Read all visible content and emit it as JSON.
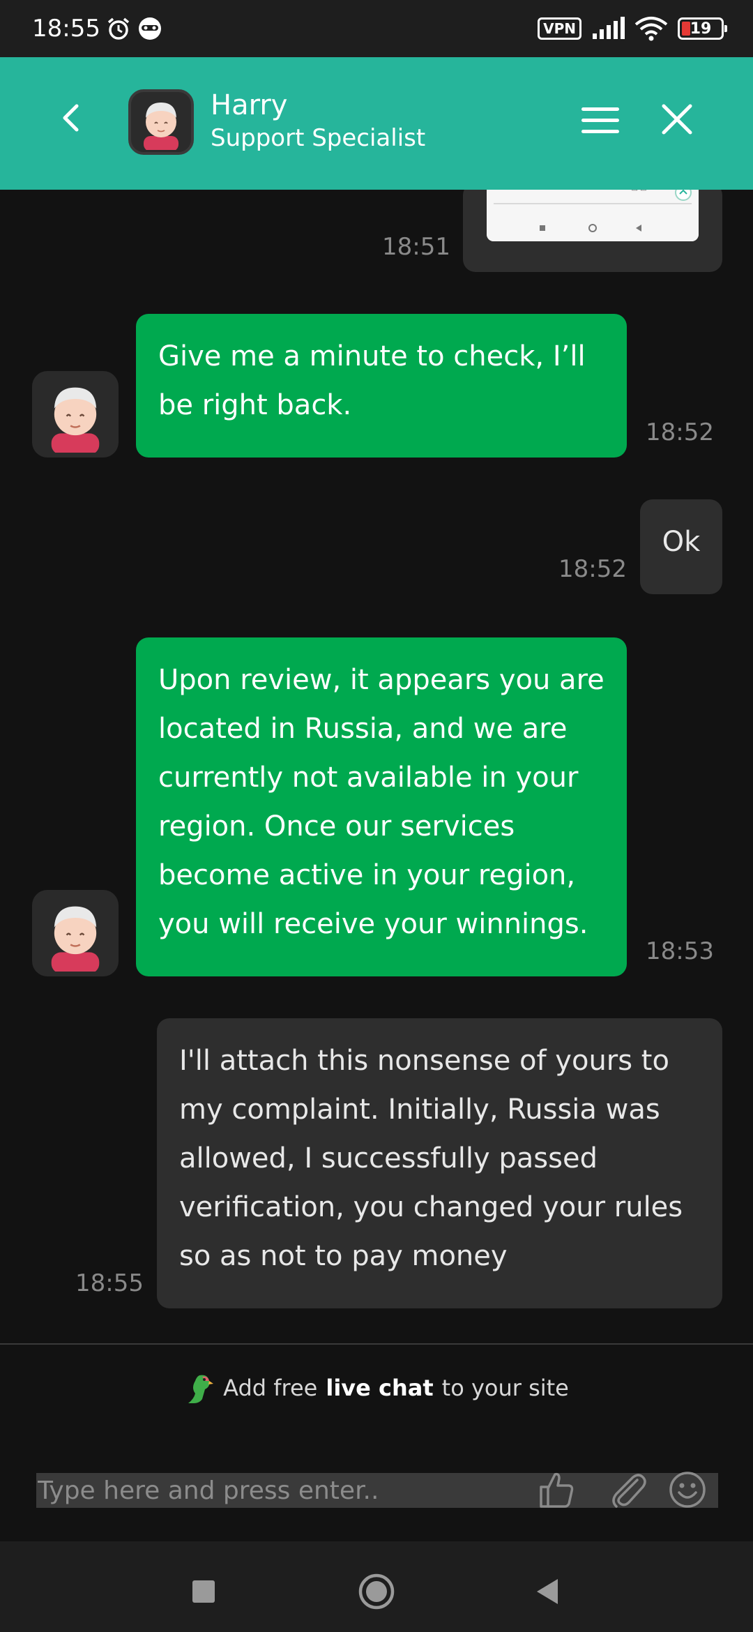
{
  "status_bar": {
    "time": "18:55",
    "alarm_icon": "alarm-clock-icon",
    "app_icon": "messenger-icon",
    "vpn_label": "VPN",
    "battery_level": "19"
  },
  "header": {
    "agent_name": "Harry",
    "agent_role": "Support Specialist"
  },
  "messages": [
    {
      "sender": "user",
      "type": "image",
      "time": "18:51"
    },
    {
      "sender": "agent",
      "text": "Give me a minute to check, I’ll be right back.",
      "time": "18:52"
    },
    {
      "sender": "user",
      "text": "Ok",
      "time": "18:52"
    },
    {
      "sender": "agent",
      "text": "Upon review, it appears you are located in Russia, and we are currently not available in your region. Once our services become active in your region, you will receive your winnings.",
      "time": "18:53"
    },
    {
      "sender": "user",
      "text": "I'll attach this nonsense of yours to my complaint. Initially, Russia was allowed, I successfully passed verification, you changed your rules so as not to pay money",
      "time": "18:55"
    }
  ],
  "promo": {
    "prefix": "Add free",
    "bold": "live chat",
    "suffix": "to your site"
  },
  "composer": {
    "placeholder": "Type here and press enter.."
  },
  "colors": {
    "header": "#26b59b",
    "agent_bubble": "#00a94f",
    "user_bubble": "#2e2e2e",
    "background": "#121212"
  }
}
